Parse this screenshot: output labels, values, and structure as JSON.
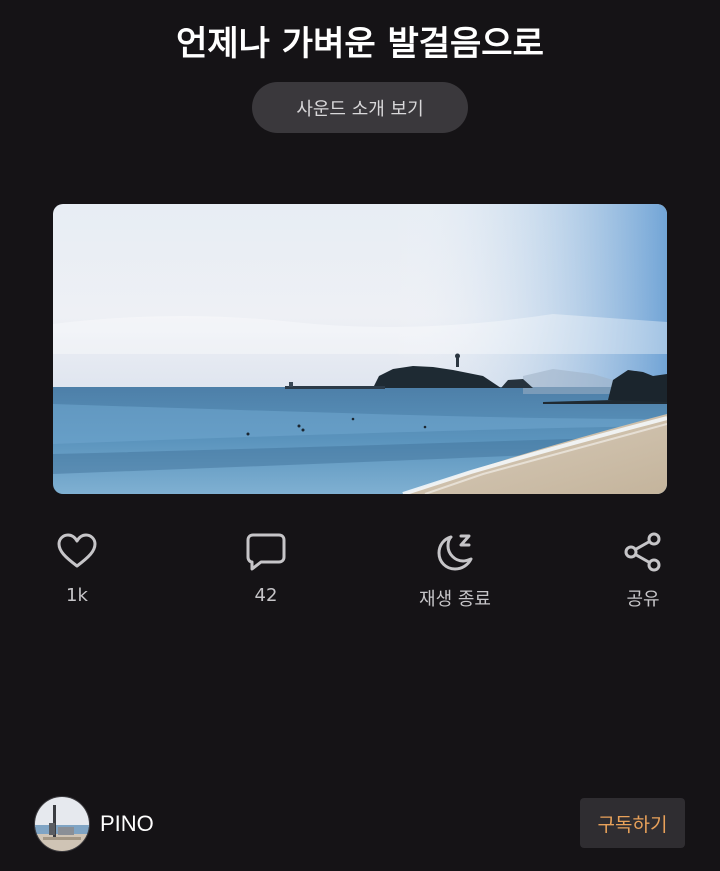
{
  "header": {
    "title": "언제나 가벼운 발걸음으로",
    "intro_button_label": "사운드 소개 보기"
  },
  "cover": {
    "image_icon": "beach-landscape"
  },
  "actions": [
    {
      "icon": "heart-icon",
      "label": "1k"
    },
    {
      "icon": "comment-icon",
      "label": "42"
    },
    {
      "icon": "sleep-timer-icon",
      "label": "재생 종료"
    },
    {
      "icon": "share-icon",
      "label": "공유"
    }
  ],
  "author": {
    "name": "PINO"
  },
  "subscribe": {
    "label": "구독하기"
  },
  "colors": {
    "background": "#151316",
    "button_bg": "#3a383c",
    "accent": "#e8a15a",
    "icon_stroke": "#c6c5c8"
  }
}
